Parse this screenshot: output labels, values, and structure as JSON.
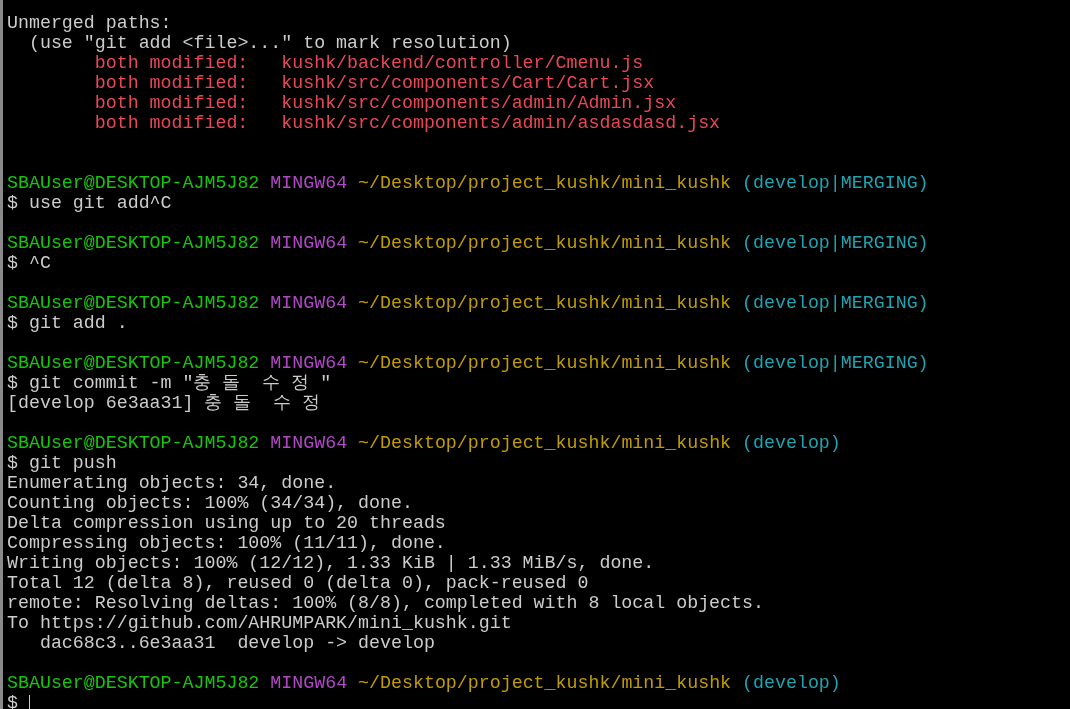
{
  "terminal": {
    "lines": [
      {
        "kind": "output",
        "text": "Unmerged paths:"
      },
      {
        "kind": "output",
        "text": "  (use \"git add <file>...\" to mark resolution)"
      },
      {
        "kind": "conflict",
        "status": "both modified:",
        "file": "kushk/backend/controller/Cmenu.js"
      },
      {
        "kind": "conflict",
        "status": "both modified:",
        "file": "kushk/src/components/Cart/Cart.jsx"
      },
      {
        "kind": "conflict",
        "status": "both modified:",
        "file": "kushk/src/components/admin/Admin.jsx"
      },
      {
        "kind": "conflict",
        "status": "both modified:",
        "file": "kushk/src/components/admin/asdasdasd.jsx"
      },
      {
        "kind": "blank"
      },
      {
        "kind": "blank"
      },
      {
        "kind": "prompt",
        "user": "SBAUser@DESKTOP-AJM5J82",
        "system": "MINGW64",
        "path": "~/Desktop/project_kushk/mini_kushk",
        "branch": "(develop|MERGING)"
      },
      {
        "kind": "command",
        "text": "$ use git add^C"
      },
      {
        "kind": "blank"
      },
      {
        "kind": "prompt",
        "user": "SBAUser@DESKTOP-AJM5J82",
        "system": "MINGW64",
        "path": "~/Desktop/project_kushk/mini_kushk",
        "branch": "(develop|MERGING)"
      },
      {
        "kind": "command",
        "text": "$ ^C"
      },
      {
        "kind": "blank"
      },
      {
        "kind": "prompt",
        "user": "SBAUser@DESKTOP-AJM5J82",
        "system": "MINGW64",
        "path": "~/Desktop/project_kushk/mini_kushk",
        "branch": "(develop|MERGING)"
      },
      {
        "kind": "command",
        "text": "$ git add ."
      },
      {
        "kind": "blank"
      },
      {
        "kind": "prompt",
        "user": "SBAUser@DESKTOP-AJM5J82",
        "system": "MINGW64",
        "path": "~/Desktop/project_kushk/mini_kushk",
        "branch": "(develop|MERGING)"
      },
      {
        "kind": "command",
        "text": "$ git commit -m \"충 돌  수 정 \""
      },
      {
        "kind": "output",
        "text": "[develop 6e3aa31] 충 돌  수 정"
      },
      {
        "kind": "blank"
      },
      {
        "kind": "prompt",
        "user": "SBAUser@DESKTOP-AJM5J82",
        "system": "MINGW64",
        "path": "~/Desktop/project_kushk/mini_kushk",
        "branch": "(develop)"
      },
      {
        "kind": "command",
        "text": "$ git push"
      },
      {
        "kind": "output",
        "text": "Enumerating objects: 34, done."
      },
      {
        "kind": "output",
        "text": "Counting objects: 100% (34/34), done."
      },
      {
        "kind": "output",
        "text": "Delta compression using up to 20 threads"
      },
      {
        "kind": "output",
        "text": "Compressing objects: 100% (11/11), done."
      },
      {
        "kind": "output",
        "text": "Writing objects: 100% (12/12), 1.33 KiB | 1.33 MiB/s, done."
      },
      {
        "kind": "output",
        "text": "Total 12 (delta 8), reused 0 (delta 0), pack-reused 0"
      },
      {
        "kind": "output",
        "text": "remote: Resolving deltas: 100% (8/8), completed with 8 local objects."
      },
      {
        "kind": "output",
        "text": "To https://github.com/AHRUMPARK/mini_kushk.git"
      },
      {
        "kind": "output",
        "text": "   dac68c3..6e3aa31  develop -> develop"
      },
      {
        "kind": "blank"
      },
      {
        "kind": "prompt",
        "user": "SBAUser@DESKTOP-AJM5J82",
        "system": "MINGW64",
        "path": "~/Desktop/project_kushk/mini_kushk",
        "branch": "(develop)"
      },
      {
        "kind": "input",
        "text": "$"
      }
    ]
  }
}
